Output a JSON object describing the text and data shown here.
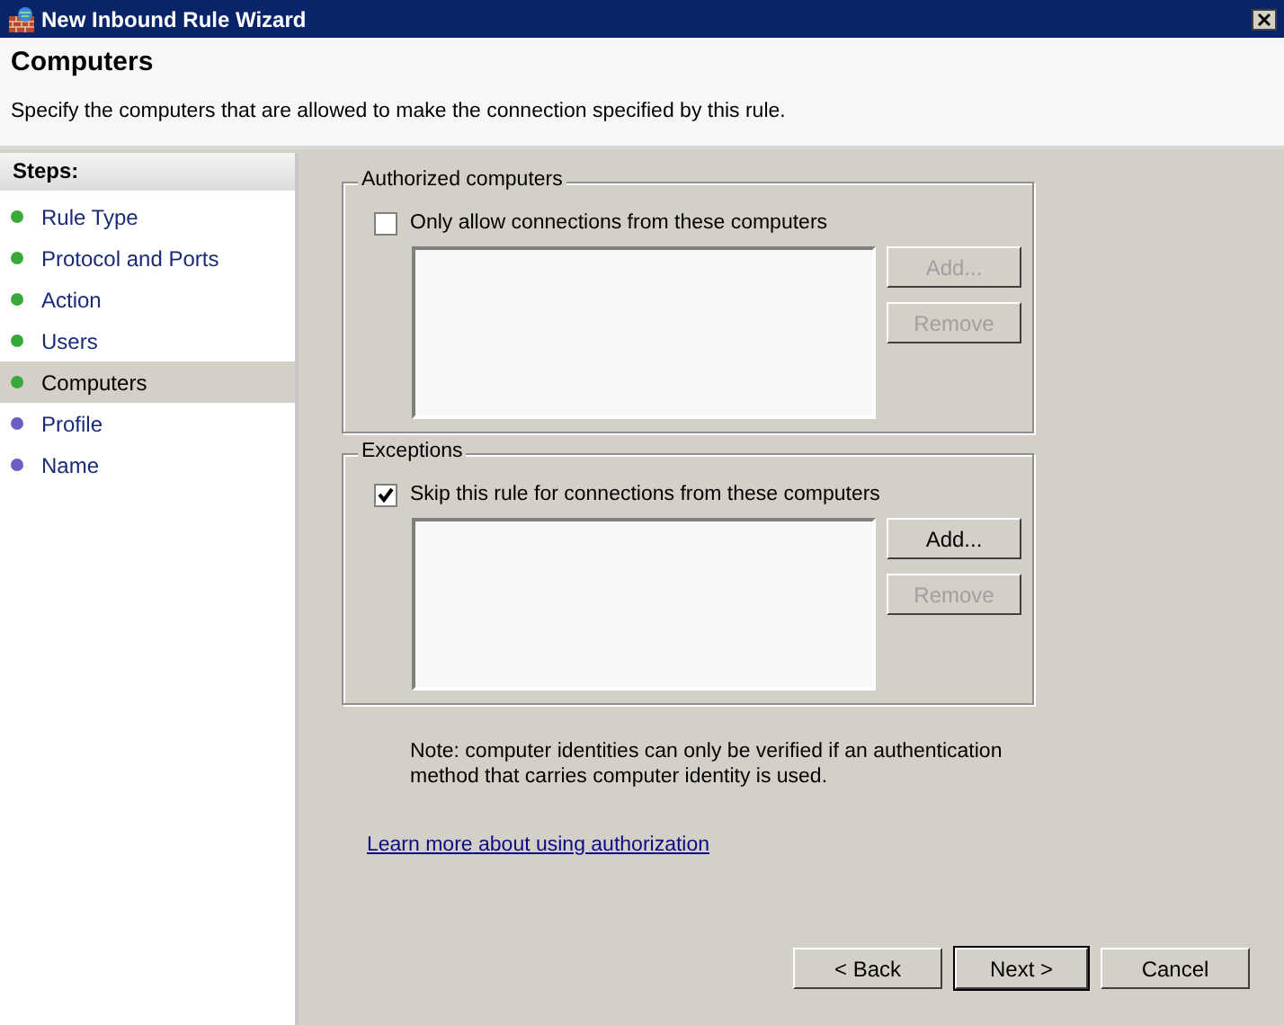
{
  "window": {
    "title": "New Inbound Rule Wizard"
  },
  "header": {
    "title": "Computers",
    "subtitle": "Specify the computers that are allowed to make the connection specified by this rule."
  },
  "sidebar": {
    "heading": "Steps:",
    "items": [
      {
        "label": "Rule Type",
        "selected": false,
        "color": "#3aa83a"
      },
      {
        "label": "Protocol and Ports",
        "selected": false,
        "color": "#3aa83a"
      },
      {
        "label": "Action",
        "selected": false,
        "color": "#3aa83a"
      },
      {
        "label": "Users",
        "selected": false,
        "color": "#3aa83a"
      },
      {
        "label": "Computers",
        "selected": true,
        "color": "#3aa83a"
      },
      {
        "label": "Profile",
        "selected": false,
        "color": "#6a5fc4"
      },
      {
        "label": "Name",
        "selected": false,
        "color": "#6a5fc4"
      }
    ]
  },
  "groups": [
    {
      "title": "Authorized computers",
      "checkbox": {
        "label": "Only allow connections from these computers",
        "checked": false
      },
      "buttons": [
        {
          "label": "Add...",
          "disabled": true
        },
        {
          "label": "Remove",
          "disabled": true
        }
      ]
    },
    {
      "title": "Exceptions",
      "checkbox": {
        "label": "Skip this rule for connections from these computers",
        "checked": true
      },
      "buttons": [
        {
          "label": "Add...",
          "disabled": false
        },
        {
          "label": "Remove",
          "disabled": true
        }
      ]
    }
  ],
  "note": "Note: computer identities can only be verified if an authentication method that carries computer identity is used.",
  "link": "Learn more about using authorization",
  "footer_buttons": [
    {
      "label": "< Back",
      "default": false
    },
    {
      "label": "Next >",
      "default": true
    },
    {
      "label": "Cancel",
      "default": false
    }
  ]
}
